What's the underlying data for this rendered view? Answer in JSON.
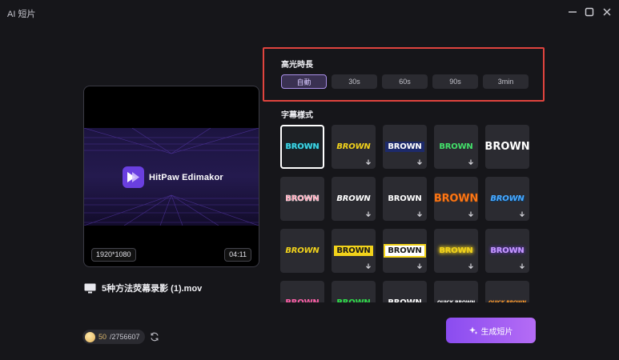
{
  "window": {
    "title": "AI 短片"
  },
  "preview": {
    "brand_name": "HitPaw Edimakor",
    "resolution": "1920*1080",
    "duration": "04:11"
  },
  "file": {
    "name": "5种方法荧幕录影 (1).mov"
  },
  "credits": {
    "used": "50",
    "total": "/2756607"
  },
  "highlight_duration": {
    "label": "高光時長",
    "selected": "自動",
    "options": [
      "自動",
      "30s",
      "60s",
      "90s",
      "3min"
    ]
  },
  "subtitle_style": {
    "label": "字幕樣式",
    "tiles": [
      {
        "text": "BROWN",
        "color": "#3fd7e8",
        "selected": true,
        "download": false
      },
      {
        "text": "BROWN",
        "color": "#f2d31b",
        "download": true
      },
      {
        "text": "BROWN",
        "color": "#ffffff",
        "download": true
      },
      {
        "text": "BROWN",
        "color": "#43e06a",
        "download": true
      },
      {
        "text": "BROWN",
        "color": "#ffffff",
        "download": false
      },
      {
        "text": "BROWN",
        "color": "#ff8fa8",
        "download": false
      },
      {
        "text": "BROWN",
        "color": "#ffffff",
        "download": true
      },
      {
        "text": "BROWN",
        "color": "#ffffff",
        "download": true
      },
      {
        "text": "BROWN",
        "color": "#ff7a1a",
        "download": true
      },
      {
        "text": "BROWN",
        "color": "#49a9ff",
        "download": true
      },
      {
        "text": "BROWN",
        "color": "#f2d31b",
        "download": false
      },
      {
        "text": "BROWN",
        "color": "#1a1a1a",
        "download": true
      },
      {
        "text": "BROWN",
        "color": "#1a1a1a",
        "download": true
      },
      {
        "text": "BROWN",
        "color": "#f2d31b",
        "download": true
      },
      {
        "text": "BROWN",
        "color": "#c89bff",
        "download": true
      },
      {
        "text": "BROWN",
        "color": "#ff5fa8",
        "download": false
      },
      {
        "text": "BROWN",
        "color": "#2ee04a",
        "download": false
      },
      {
        "text": "BROWN",
        "color": "#ffffff",
        "download": false
      },
      {
        "text": "QUICK BROWN",
        "color": "#ffffff",
        "download": false
      },
      {
        "text": "QUICK BROWN",
        "color": "#ff9a2a",
        "download": false
      }
    ]
  },
  "generate_button": {
    "label": "生成短片"
  },
  "colors": {
    "accent": "#a98fe8",
    "highlight_border": "#e0443e",
    "button_gradient_start": "#8a4cf0",
    "button_gradient_end": "#b56cf5"
  }
}
